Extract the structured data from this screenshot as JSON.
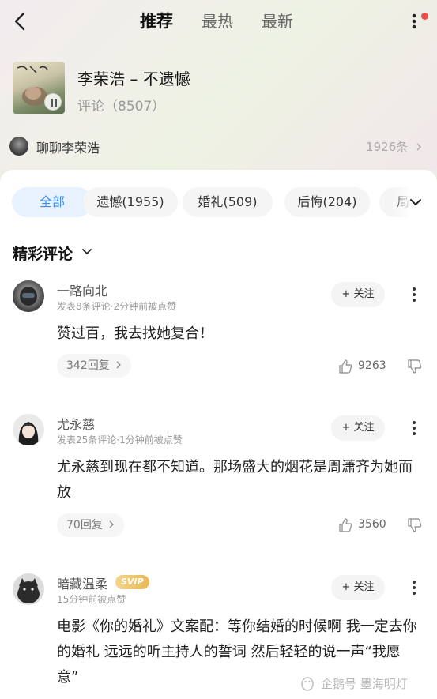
{
  "header": {
    "tabs": [
      "推荐",
      "最热",
      "最新"
    ],
    "active_tab": "推荐"
  },
  "song": {
    "title": "李荣浩 – 不遗憾",
    "comments_label": "评论（8507）"
  },
  "artist_chat": {
    "label": "聊聊李荣浩",
    "count": "1926条"
  },
  "filters": [
    "全部",
    "遗憾(1955)",
    "婚礼(509)",
    "后悔(204)",
    "局"
  ],
  "section_title": "精彩评论",
  "comments": [
    {
      "name": "一路向北",
      "meta": "发表8条评论·2分钟前被点赞",
      "follow_label": "+ 关注",
      "text": "赞过百，我去找她复合！",
      "replies": "342回复",
      "likes": "9263"
    },
    {
      "name": "尤永慈",
      "meta": "发表25条评论·1分钟前被点赞",
      "follow_label": "+ 关注",
      "text": "尤永慈到现在都不知道。那场盛大的烟花是周潇齐为她而放",
      "replies": "70回复",
      "likes": "3560"
    },
    {
      "name": "暗藏温柔",
      "badge": "SVIP",
      "meta": "15分钟前被点赞",
      "follow_label": "+ 关注",
      "text": "电影《你的婚礼》文案配：等你结婚的时候啊 我一定去你的婚礼 远远的听主持人的誓词 然后轻轻的说一声“我愿意”"
    }
  ],
  "watermark": "企鹅号 墨海明灯",
  "colors": {
    "accent": "#3e8cf0",
    "notification_dot": "#ee4b4b",
    "svip_gold": "#e8b955"
  }
}
